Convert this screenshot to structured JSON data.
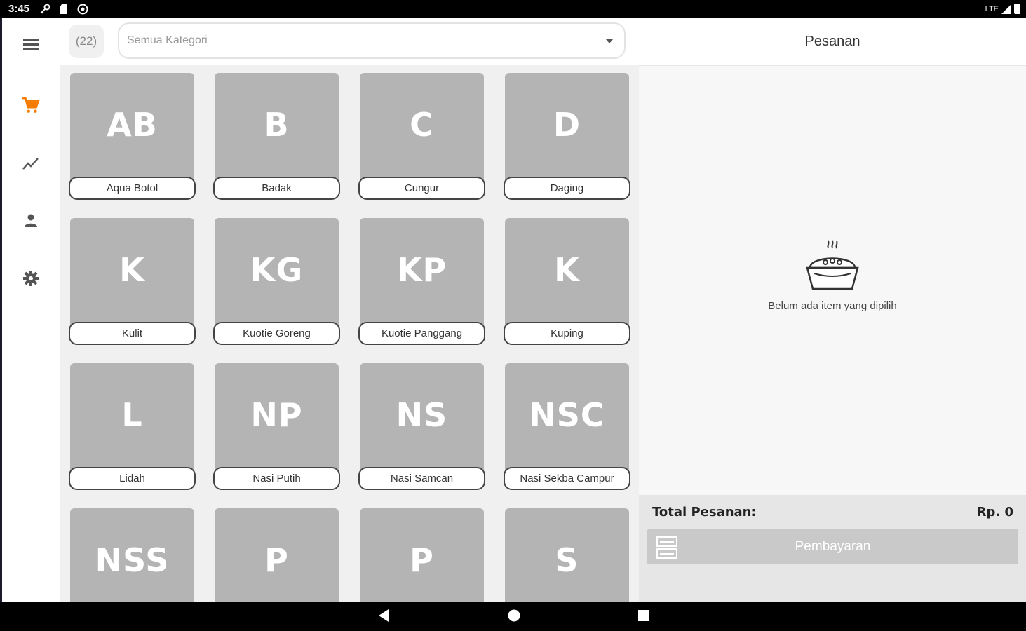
{
  "status_bar": {
    "time": "3:45",
    "network": "LTE"
  },
  "nav_rail": {
    "items": [
      {
        "icon": "menu-icon"
      },
      {
        "icon": "cart-icon",
        "active": true
      },
      {
        "icon": "chart-icon"
      },
      {
        "icon": "person-icon"
      },
      {
        "icon": "gear-icon"
      }
    ],
    "active_color": "#f57c00",
    "icon_color": "#555555"
  },
  "catalog": {
    "count": "(22)",
    "category_placeholder": "Semua Kategori",
    "products": [
      {
        "initials": "AB",
        "name": "Aqua Botol"
      },
      {
        "initials": "B",
        "name": "Badak"
      },
      {
        "initials": "C",
        "name": "Cungur"
      },
      {
        "initials": "D",
        "name": "Daging"
      },
      {
        "initials": "K",
        "name": "Kulit"
      },
      {
        "initials": "KG",
        "name": "Kuotie Goreng"
      },
      {
        "initials": "KP",
        "name": "Kuotie Panggang"
      },
      {
        "initials": "K",
        "name": "Kuping"
      },
      {
        "initials": "L",
        "name": "Lidah"
      },
      {
        "initials": "NP",
        "name": "Nasi Putih"
      },
      {
        "initials": "NS",
        "name": "Nasi Samcan"
      },
      {
        "initials": "NSC",
        "name": "Nasi Sekba Campur"
      },
      {
        "initials": "NSS",
        "name": ""
      },
      {
        "initials": "P",
        "name": ""
      },
      {
        "initials": "P",
        "name": ""
      },
      {
        "initials": "S",
        "name": ""
      }
    ],
    "tile_color": "#b4b4b4"
  },
  "orders": {
    "title": "Pesanan",
    "empty_message": "Belum ada item yang dipilih",
    "total_label": "Total Pesanan:",
    "total_value": "Rp. 0",
    "pay_button": "Pembayaran"
  }
}
